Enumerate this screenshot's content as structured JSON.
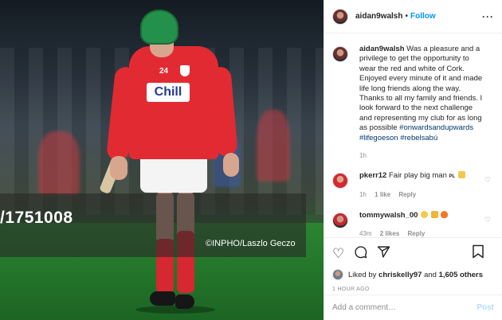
{
  "photo": {
    "watermark_id": "/1751008",
    "credit": "©INPHO/Laszlo Geczo",
    "sponsor": "Chill",
    "jersey_number": "24"
  },
  "header": {
    "username": "aidan9walsh",
    "separator": "•",
    "follow_label": "Follow",
    "more": "···"
  },
  "caption": {
    "username": "aidan9walsh",
    "text": "Was a pleasure and a privilege to get the opportunity to wear the red and white of Cork. Enjoyed every minute of it and made life long friends along the way. Thanks to all my family and friends. I look forward to the next challenge and representing my club for as long as possible",
    "hashtags": "#onwardsandupwards #lifegoeson #rebelsabú",
    "time": "1h"
  },
  "comments": [
    {
      "username": "pkerr12",
      "text": "Fair play big man",
      "emoji": "PL",
      "time": "1h",
      "likes": "1 like",
      "reply": "Reply"
    },
    {
      "username": "tommywalsh_00",
      "text": "",
      "emoji": "",
      "time": "43m",
      "likes": "2 likes",
      "reply": "Reply"
    }
  ],
  "actions": {
    "liked_prefix": "Liked by",
    "liked_user": "chriskelly97",
    "and": "and",
    "others": "1,605 others",
    "date": "1 HOUR AGO"
  },
  "add_comment": {
    "placeholder": "Add a comment…",
    "post_label": "Post"
  },
  "colors": {
    "link": "#0095f6",
    "hashtag": "#00376b",
    "muted": "#8e8e8e",
    "jersey": "#e22a32",
    "helmet": "#23914b"
  }
}
